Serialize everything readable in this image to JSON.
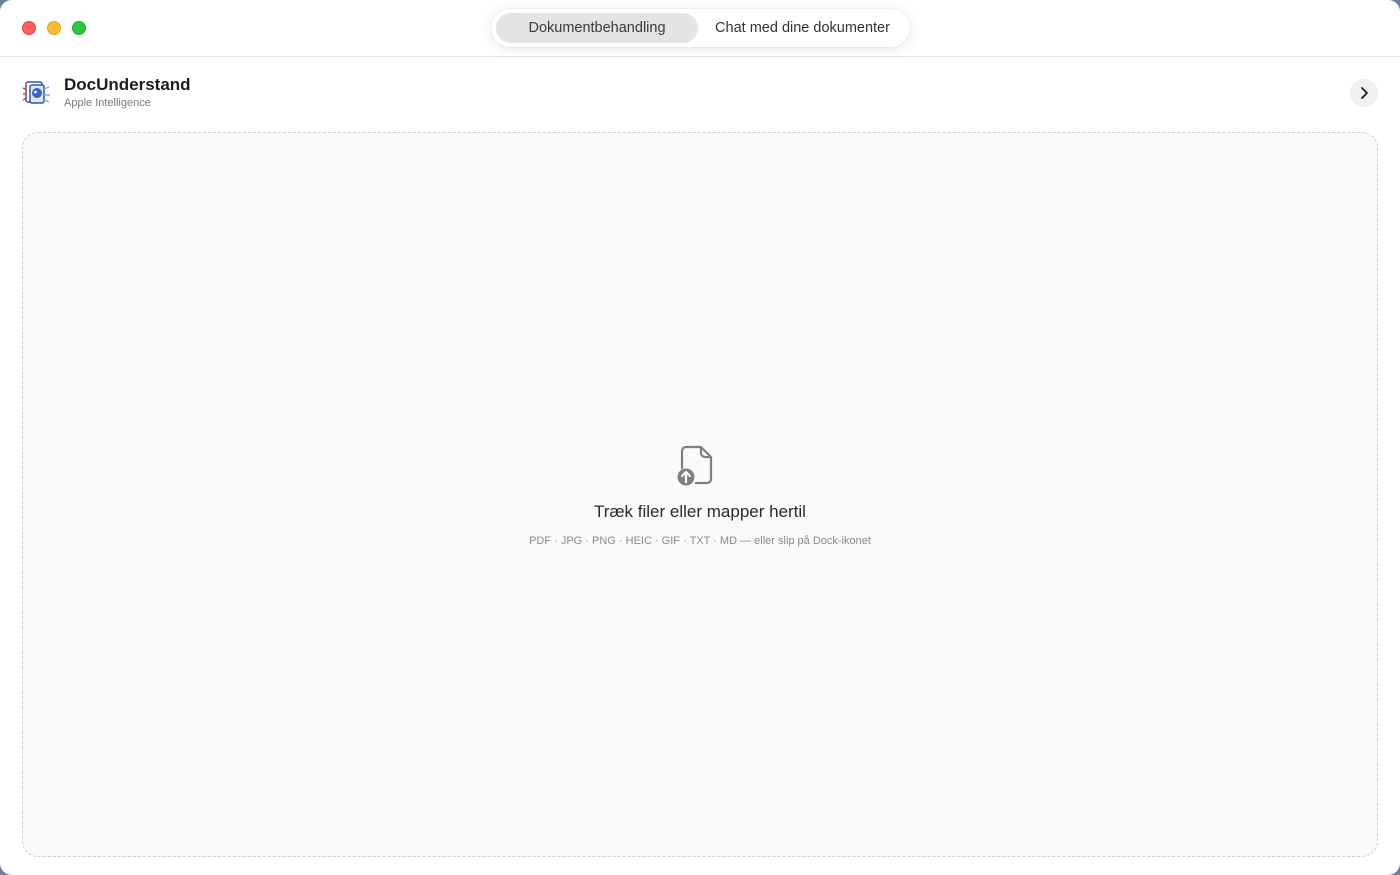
{
  "window": {
    "controls": {
      "close_icon": "close-icon",
      "minimize_icon": "minimize-icon",
      "maximize_icon": "maximize-icon"
    }
  },
  "segmented": {
    "tabs": [
      {
        "label": "Dokumentbehandling",
        "selected": true
      },
      {
        "label": "Chat med dine dokumenter",
        "selected": false
      }
    ]
  },
  "app": {
    "name": "DocUnderstand",
    "subtitle": "Apple Intelligence",
    "logo_icon": "app-logo-icon",
    "expand_icon": "chevron-right-icon"
  },
  "dropzone": {
    "icon": "document-upload-icon",
    "title": "Træk filer eller mapper hertil",
    "formats": "PDF · JPG · PNG · HEIC · GIF · TXT · MD — eller slip på Dock-ikonet"
  },
  "colors": {
    "close": "#fe5f57",
    "minimize": "#febc2e",
    "maximize": "#28c840",
    "selected_tab": "#e4e4e4",
    "dropzone_border": "#cfcfcf",
    "dropzone_bg": "#fafafa"
  }
}
